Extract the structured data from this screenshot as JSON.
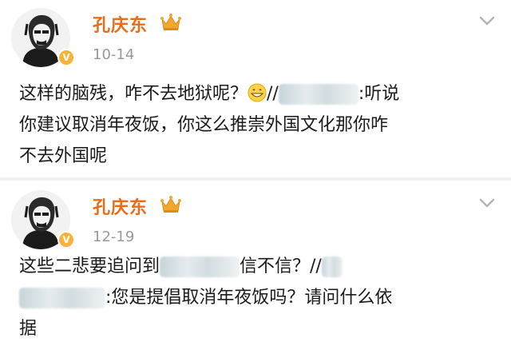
{
  "posts": [
    {
      "author": "孔庆东",
      "date": "10-14",
      "text_part1": "这样的脑残，咋不去地狱呢？",
      "repost_sep": "//",
      "text_part2": ":听说",
      "text_line2": "你建议取消年夜饭，你这么推崇外国文化那你咋",
      "text_line3": "不去外国呢",
      "badge": "V"
    },
    {
      "author": "孔庆东",
      "date": "12-19",
      "text_part1": "这些二悲要追问到",
      "text_part2": "信不信？//",
      "text_part3": ":您是提倡取消年夜饭吗？请问什么依",
      "text_line3": "据",
      "badge": "V"
    }
  ],
  "icons": {
    "crown": "crown-icon",
    "more": "chevron-down-icon",
    "emoji": "grin-emoji-icon"
  },
  "colors": {
    "name": "#e86d1b",
    "date": "#999999",
    "badge": "#f7b23a",
    "text": "#1a1a1a"
  }
}
